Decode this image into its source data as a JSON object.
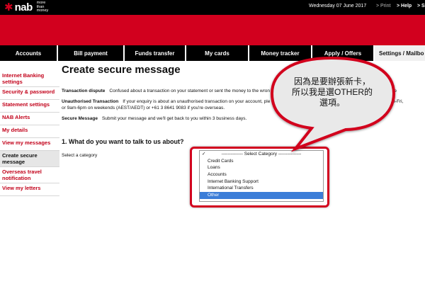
{
  "header": {
    "logo_text": "nab",
    "logo_tagline": "more than money",
    "date": "Wednesday 07 June 2017",
    "print_label": "> Print",
    "help_label": "> Help",
    "signout_label": "> S"
  },
  "nav": {
    "tabs": [
      {
        "label": "Accounts"
      },
      {
        "label": "Bill payment"
      },
      {
        "label": "Funds transfer"
      },
      {
        "label": "My cards"
      },
      {
        "label": "Money tracker"
      },
      {
        "label": "Apply / Offers"
      },
      {
        "label": "Settings / Mailbo"
      }
    ]
  },
  "sidebar": {
    "items": [
      {
        "label": "Internet Banking settings"
      },
      {
        "label": "Security & password"
      },
      {
        "label": "Statement settings"
      },
      {
        "label": "NAB Alerts"
      },
      {
        "label": "My details"
      },
      {
        "label": "View my messages"
      },
      {
        "label": "Create secure message"
      },
      {
        "label": "Overseas travel notification"
      },
      {
        "label": "View my letters"
      }
    ]
  },
  "main": {
    "title": "Create secure message",
    "dispute_title": "Transaction dispute",
    "dispute_text": "Confused about a transaction on your statement or sent the money to the wron",
    "dispute_link": "here",
    "unauth_title": "Unauthorised Transaction",
    "unauth_text_1": "If your enquiry is about an unauthorised transaction on your account, ple",
    "unauth_text_1_tail": "m Mon-Fri,",
    "unauth_text_2": "or 9am-6pm on weekends (AEST/AEDT) or +61 3 8641 9083 if you're overseas.",
    "secure_title": "Secure Message",
    "secure_text": "Submit your message and we'll get back to you within 3 business days.",
    "question": "1. What do you want to talk to us about?",
    "category_label": "Select a category"
  },
  "dropdown": {
    "header": "-------------- Select Category ---------------",
    "options": [
      {
        "label": "Credit Cards"
      },
      {
        "label": "Loans"
      },
      {
        "label": "Accounts"
      },
      {
        "label": "Internet Banking Support"
      },
      {
        "label": "International Transfers"
      },
      {
        "label": "Other"
      }
    ],
    "selected": "Other"
  },
  "annotation": {
    "lines": [
      "因為是要辦張新卡，",
      "所以我是選OTHER的",
      "選項。"
    ]
  },
  "colors": {
    "brand_red": "#d2001e",
    "link_red": "#c20019",
    "highlight_blue": "#3b7dd8"
  }
}
